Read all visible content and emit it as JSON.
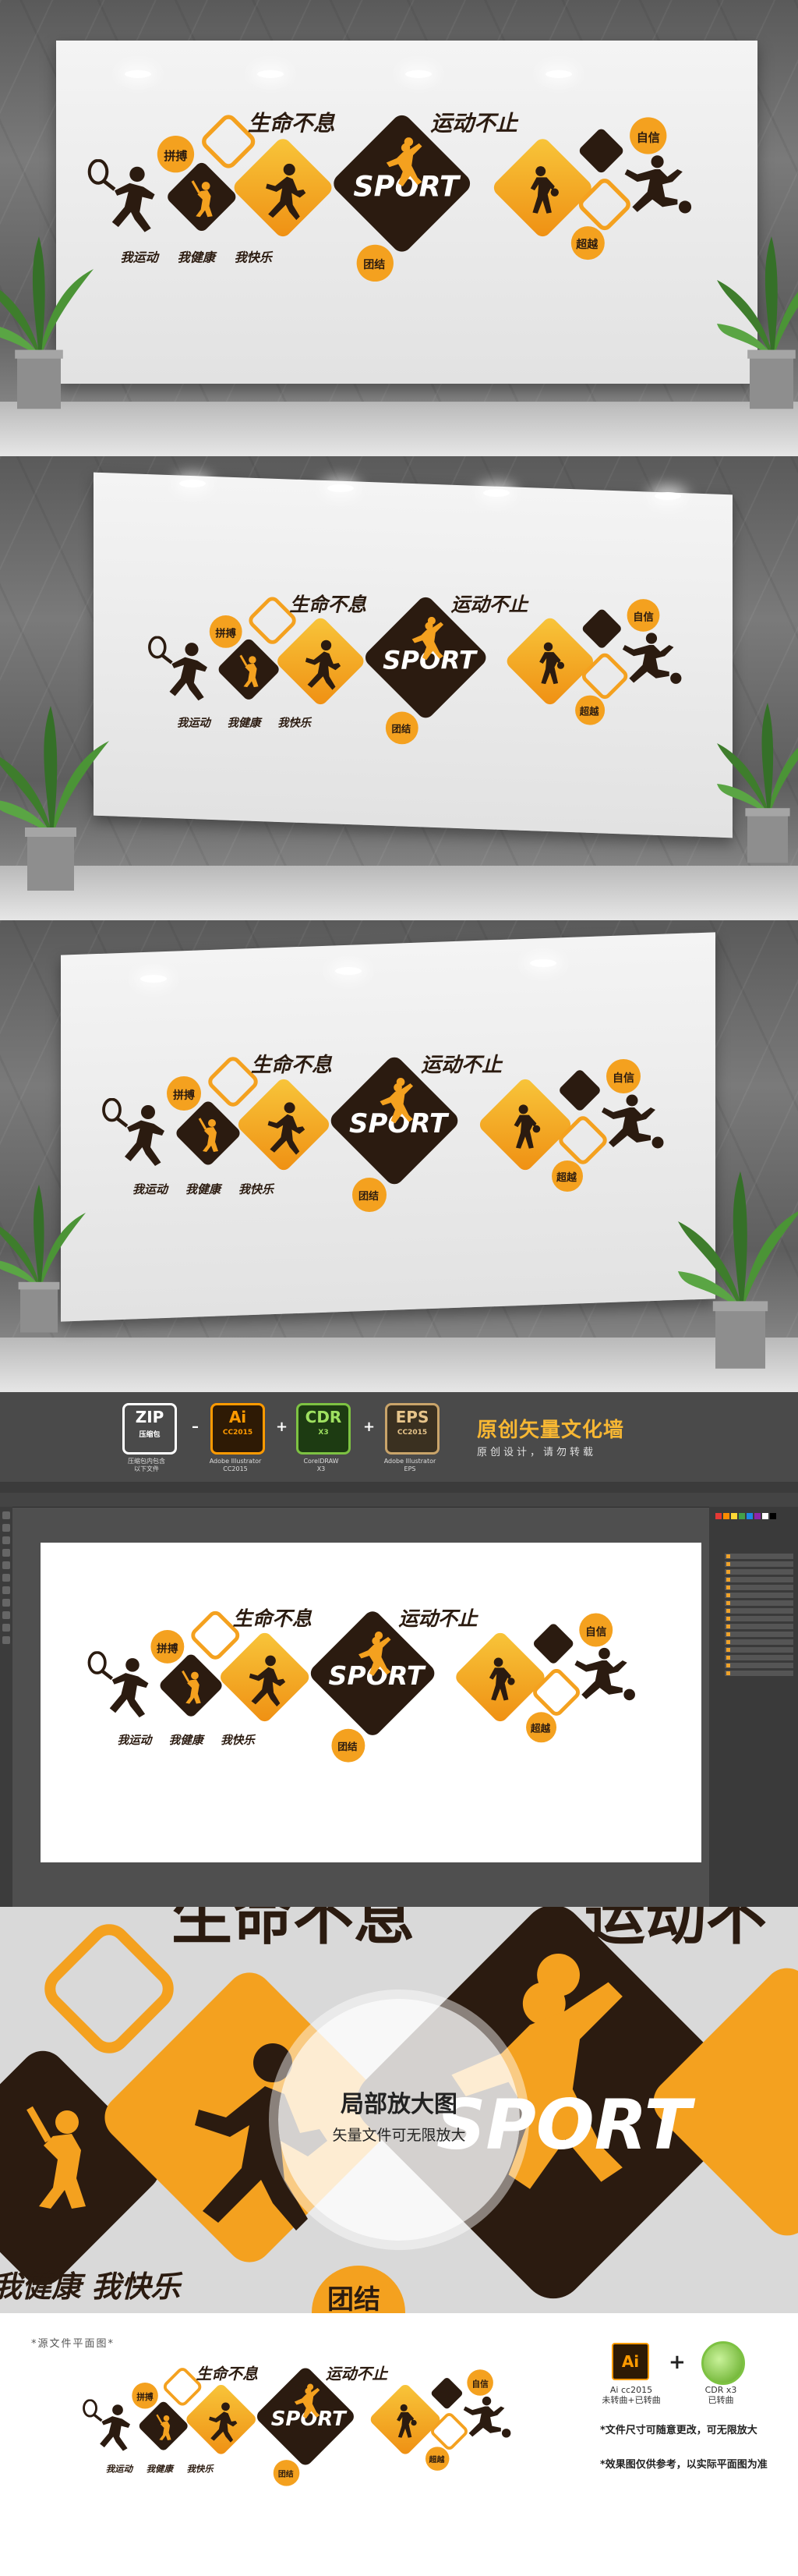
{
  "design": {
    "headline_left": "生命不息",
    "headline_right": "运动不止",
    "sport": "SPORT",
    "badges": {
      "pinbo": "拼搏",
      "zixin": "自信",
      "chaoyue": "超越",
      "tuanjie": "团结"
    },
    "slogans": [
      "我运动",
      "我健康",
      "我快乐"
    ],
    "colors": {
      "orange": "#f4a11f",
      "orange_light": "#f8c63b",
      "dark": "#2b1b10"
    }
  },
  "formats": {
    "zip": {
      "big": "ZIP",
      "small": "压缩包",
      "caption": "压缩包内包含\n以下文件"
    },
    "ai": {
      "big": "Ai",
      "small": "CC2015",
      "caption": "Adobe Illustrator\nCC2015"
    },
    "cdr": {
      "big": "CDR",
      "small": "X3",
      "caption": "CorelDRAW\nX3"
    },
    "eps": {
      "big": "EPS",
      "small": "CC2015",
      "caption": "Adobe Illustrator\nEPS"
    },
    "title": "原创矢量文化墙",
    "subtitle": "原创设计，请勿转载"
  },
  "zoom": {
    "title": "局部放大图",
    "subtitle": "矢量文件可无限放大",
    "bg_text_1": "生命不息",
    "bg_text_2": "运动不",
    "bg_text_3": "我健康 我快乐",
    "bg_text_4": "团结"
  },
  "source": {
    "title": "*源文件平面图*",
    "ai_label": "Ai cc2015",
    "ai_sub": "未转曲+已转曲",
    "cdr_label": "CDR x3",
    "cdr_sub": "已转曲",
    "note1": "*文件尺寸可随意更改，可无限放大",
    "note2": "*效果图仅供参考，以实际平面图为准"
  }
}
